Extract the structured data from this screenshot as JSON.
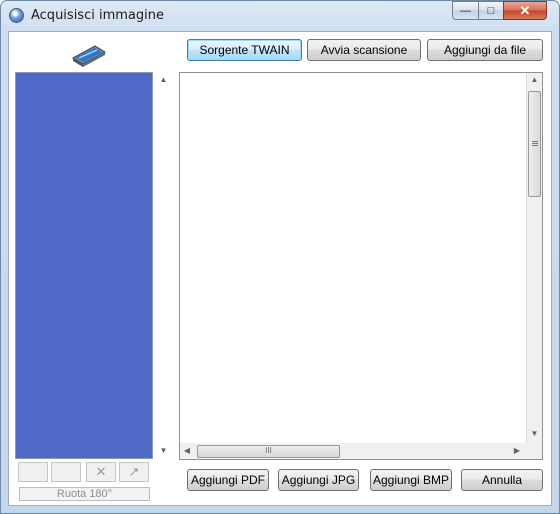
{
  "window": {
    "title": "Acquisisci immagine",
    "minimize_glyph": "—",
    "maximize_glyph": "□",
    "close_glyph": "✕"
  },
  "toolbar": {
    "twain_source_label": "Sorgente TWAIN",
    "start_scan_label": "Avvia scansione",
    "add_from_file_label": "Aggiungi da file"
  },
  "thumbnail_panel": {
    "color": "#4e69c6",
    "rotate_label": "Ruota 180°",
    "delete_glyph": "✕",
    "expand_glyph": "↗"
  },
  "preview": {
    "hscroll_grip": "III"
  },
  "footer": {
    "add_pdf_label": "Aggiungi PDF",
    "add_jpg_label": "Aggiungi JPG",
    "add_bmp_label": "Aggiungi BMP",
    "cancel_label": "Annulla"
  },
  "icons": [
    "scanner-icon",
    "window-app-icon",
    "delete-icon",
    "expand-icon"
  ]
}
